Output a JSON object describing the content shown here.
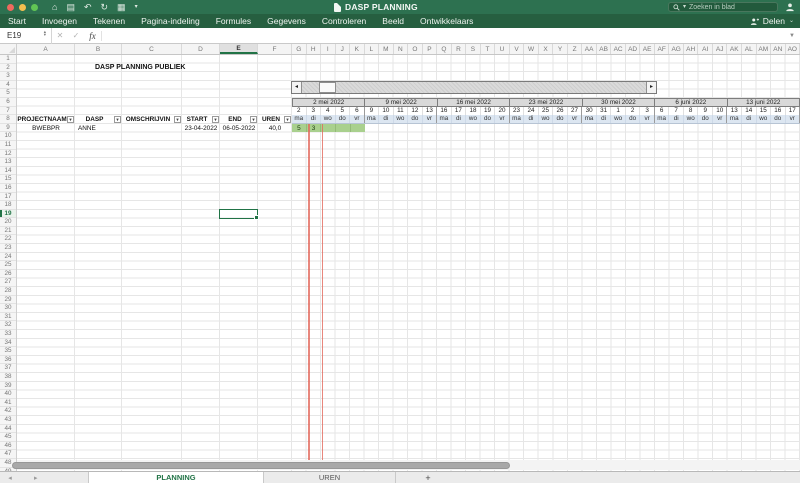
{
  "window": {
    "title": "DASP PLANNING",
    "search_placeholder": "Zoeken in blad",
    "share_label": "Delen",
    "quick_icons": [
      "home",
      "save",
      "undo",
      "redo",
      "toolbox",
      "more"
    ]
  },
  "menubar": {
    "items": [
      "Start",
      "Invoegen",
      "Tekenen",
      "Pagina-indeling",
      "Formules",
      "Gegevens",
      "Controleren",
      "Beeld",
      "Ontwikkelaars"
    ]
  },
  "formula_bar": {
    "name_box": "E19",
    "cancel_glyph": "✕",
    "enter_glyph": "✓",
    "fx_label": "fx"
  },
  "columns": {
    "wide": [
      "A",
      "B",
      "C",
      "D",
      "E",
      "F"
    ],
    "narrow": [
      "G",
      "H",
      "I",
      "J",
      "K",
      "L",
      "M",
      "N",
      "O",
      "P",
      "Q",
      "R",
      "S",
      "T",
      "U",
      "V",
      "W",
      "X",
      "Y",
      "Z",
      "AA",
      "AB",
      "AC",
      "AD",
      "AE",
      "AF",
      "AG",
      "AH",
      "AI",
      "AJ",
      "AK",
      "AL",
      "AM",
      "AN",
      "AO"
    ]
  },
  "rows": {
    "count": 49,
    "selected": 19
  },
  "selection": {
    "cell": "E19",
    "column": "E",
    "row": 19
  },
  "content": {
    "sheet_title": "DASP PLANNING PUBLIEK",
    "table": {
      "headers": [
        "PROJECTNAAM",
        "DASP",
        "OMSCHRIJVIN",
        "START",
        "END",
        "UREN"
      ],
      "data_row": [
        "BWEBPR",
        "ANNE",
        "",
        "23-04-2022",
        "06-05-2022",
        "40,0"
      ]
    },
    "gantt": {
      "day_names": [
        "ma",
        "di",
        "wo",
        "do",
        "vr"
      ],
      "weeks": [
        {
          "label": "2 mei 2022",
          "days": [
            "2",
            "3",
            "4",
            "5",
            "6"
          ]
        },
        {
          "label": "9 mei 2022",
          "days": [
            "9",
            "10",
            "11",
            "12",
            "13"
          ]
        },
        {
          "label": "16 mei 2022",
          "days": [
            "16",
            "17",
            "18",
            "19",
            "20"
          ]
        },
        {
          "label": "23 mei 2022",
          "days": [
            "23",
            "24",
            "25",
            "26",
            "27"
          ]
        },
        {
          "label": "30 mei 2022",
          "days": [
            "30",
            "31",
            "1",
            "2",
            "3"
          ]
        },
        {
          "label": "6 juni 2022",
          "days": [
            "6",
            "7",
            "8",
            "9",
            "10"
          ]
        },
        {
          "label": "13 juni 2022",
          "days": [
            "13",
            "14",
            "15",
            "16",
            "17"
          ]
        }
      ],
      "bar_cells": [
        "5",
        "3",
        "",
        "",
        ""
      ]
    }
  },
  "tabs": {
    "sheets": [
      {
        "label": "PLANNING",
        "active": true
      },
      {
        "label": "UREN",
        "active": false
      }
    ],
    "add_label": "+"
  },
  "colors": {
    "accent": "#217346",
    "titlebar": "#2d7150",
    "menubar": "#265f40",
    "gantt_bar": "#a9d08e",
    "day_header_bg": "#dce6f1",
    "week_header_bg": "#d9d9d9",
    "today_line": "#e2695c",
    "traffic": [
      "#ed6a5e",
      "#f5bf4f",
      "#61c554"
    ]
  }
}
